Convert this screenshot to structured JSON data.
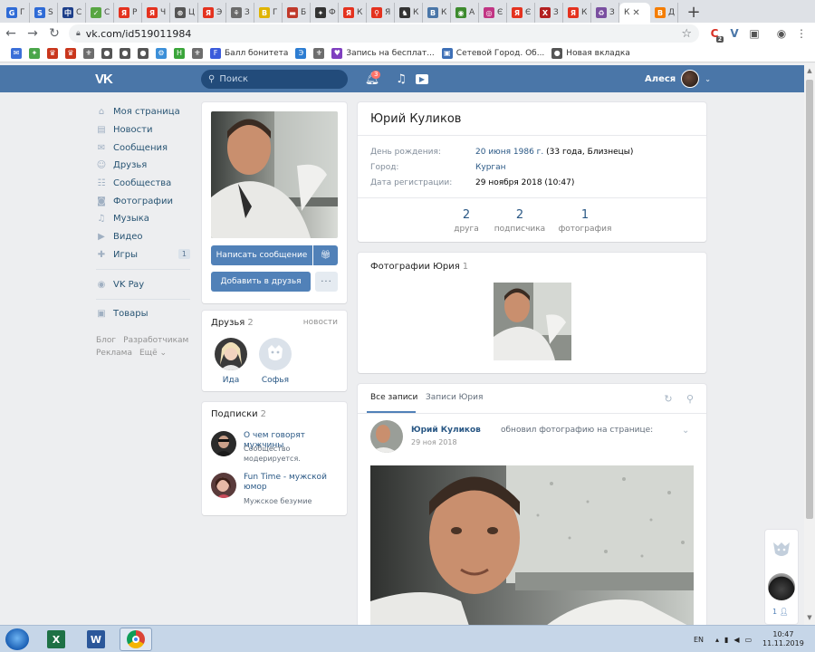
{
  "browser": {
    "tabs": [
      {
        "glyph": "G",
        "color": "#2f6bd6",
        "label": "Г"
      },
      {
        "glyph": "S",
        "color": "#2f6bd6",
        "label": "S"
      },
      {
        "glyph": "中",
        "color": "#1d3f8a",
        "label": "С"
      },
      {
        "glyph": "✓",
        "color": "#58a642",
        "label": "С"
      },
      {
        "glyph": "Я",
        "color": "#e4321f",
        "label": "Р"
      },
      {
        "glyph": "Я",
        "color": "#e4321f",
        "label": "Ч"
      },
      {
        "glyph": "⊛",
        "color": "#555555",
        "label": "Ц"
      },
      {
        "glyph": "Я",
        "color": "#e4321f",
        "label": "Э"
      },
      {
        "glyph": "⚘",
        "color": "#6b6b6b",
        "label": "З"
      },
      {
        "glyph": "B",
        "color": "#e0b400",
        "label": "Г"
      },
      {
        "glyph": "▬",
        "color": "#c0392b",
        "label": "Б"
      },
      {
        "glyph": "✦",
        "color": "#333333",
        "label": "Ф"
      },
      {
        "glyph": "Я",
        "color": "#e4321f",
        "label": "К"
      },
      {
        "glyph": "⚲",
        "color": "#e4321f",
        "label": "Я"
      },
      {
        "glyph": "♞",
        "color": "#333333",
        "label": "К"
      },
      {
        "glyph": "В",
        "color": "#4a76a8",
        "label": "К"
      },
      {
        "glyph": "◉",
        "color": "#3d8b2e",
        "label": "А"
      },
      {
        "glyph": "◎",
        "color": "#c13584",
        "label": "Є"
      },
      {
        "glyph": "Я",
        "color": "#e4321f",
        "label": "Є"
      },
      {
        "glyph": "X",
        "color": "#b32020",
        "label": "З"
      },
      {
        "glyph": "Я",
        "color": "#e4321f",
        "label": "К"
      },
      {
        "glyph": "♻",
        "color": "#7a4fa0",
        "label": "З"
      }
    ],
    "active_tab": {
      "label": "К"
    },
    "trailing_tab": {
      "glyph": "B",
      "color": "#f57d00",
      "label": "Д"
    },
    "url": "vk.com/id519011984",
    "ext_badge": "2",
    "bookmarks": [
      {
        "glyph": "✉",
        "color": "#3b6fd8",
        "label": ""
      },
      {
        "glyph": "✦",
        "color": "#4aa64a",
        "label": ""
      },
      {
        "glyph": "♛",
        "color": "#c9361c",
        "label": ""
      },
      {
        "glyph": "♛",
        "color": "#c9361c",
        "label": ""
      },
      {
        "glyph": "⚜",
        "color": "#6d6d6d",
        "label": ""
      },
      {
        "glyph": "●",
        "color": "#555555",
        "label": ""
      },
      {
        "glyph": "●",
        "color": "#555555",
        "label": ""
      },
      {
        "glyph": "●",
        "color": "#555555",
        "label": ""
      },
      {
        "glyph": "⚙",
        "color": "#3c8fd8",
        "label": ""
      },
      {
        "glyph": "H",
        "color": "#3aa53a",
        "label": ""
      },
      {
        "glyph": "⚜",
        "color": "#6d6d6d",
        "label": ""
      },
      {
        "glyph": "F",
        "color": "#3b5bdb",
        "label": "Балл бонитета"
      },
      {
        "glyph": "Э",
        "color": "#2d7dd2",
        "label": ""
      },
      {
        "glyph": "⚜",
        "color": "#6d6d6d",
        "label": ""
      },
      {
        "glyph": "♥",
        "color": "#7f3fbf",
        "label": "Запись на бесплат..."
      },
      {
        "glyph": "▣",
        "color": "#3d6fb6",
        "label": "Сетевой Город. Об..."
      },
      {
        "glyph": "●",
        "color": "#555555",
        "label": "Новая вкладка"
      }
    ]
  },
  "vk_header": {
    "logo": "VK",
    "search_placeholder": "Поиск",
    "notif_badge": "3",
    "user_name": "Алеся"
  },
  "left_menu": {
    "items": [
      {
        "icon": "home-icon",
        "glyph": "⌂",
        "label": "Моя страница",
        "count": ""
      },
      {
        "icon": "news-icon",
        "glyph": "▤",
        "label": "Новости",
        "count": ""
      },
      {
        "icon": "messages-icon",
        "glyph": "✉",
        "label": "Сообщения",
        "count": ""
      },
      {
        "icon": "friends-icon",
        "glyph": "☺",
        "label": "Друзья",
        "count": ""
      },
      {
        "icon": "communities-icon",
        "glyph": "☷",
        "label": "Сообщества",
        "count": ""
      },
      {
        "icon": "photos-icon",
        "glyph": "◙",
        "label": "Фотографии",
        "count": ""
      },
      {
        "icon": "music-icon",
        "glyph": "♫",
        "label": "Музыка",
        "count": ""
      },
      {
        "icon": "video-icon",
        "glyph": "▶",
        "label": "Видео",
        "count": ""
      },
      {
        "icon": "games-icon",
        "glyph": "✚",
        "label": "Игры",
        "count": "1"
      }
    ],
    "pay": {
      "icon": "vkpay-icon",
      "glyph": "◉",
      "label": "VK Pay"
    },
    "goods": {
      "icon": "goods-icon",
      "glyph": "▣",
      "label": "Товары"
    },
    "footer": [
      "Блог",
      "Разработчикам",
      "Реклама",
      "Ещё ⌄"
    ]
  },
  "profile": {
    "buttons": {
      "message": "Написать сообщение",
      "add_friend": "Добавить в друзья",
      "more": "···"
    },
    "friends": {
      "title": "Друзья",
      "count": "2",
      "link": "новости",
      "list": [
        {
          "name": "Ида"
        },
        {
          "name": "Софья"
        }
      ]
    },
    "subscriptions": {
      "title": "Подписки",
      "count": "2",
      "list": [
        {
          "title": "О чем говорят мужчины",
          "desc": "Сообщество модерируется."
        },
        {
          "title": "Fun Time - мужской юмор",
          "desc": "Мужское безумие"
        }
      ]
    },
    "name": "Юрий Куликов",
    "info": {
      "birthday_label": "День рождения:",
      "birthday_value": "20 июня 1986 г.",
      "birthday_extra": " (33 года, Близнецы)",
      "city_label": "Город:",
      "city_value": "Курган",
      "reg_label": "Дата регистрации:",
      "reg_value": "29 ноября 2018 (10:47)"
    },
    "counters": [
      {
        "num": "2",
        "label": "друга"
      },
      {
        "num": "2",
        "label": "подписчика"
      },
      {
        "num": "1",
        "label": "фотография"
      }
    ],
    "photos": {
      "title": "Фотографии Юрия",
      "count": "1"
    },
    "wall": {
      "tab_all": "Все записи",
      "tab_own": "Записи Юрия",
      "post": {
        "author": "Юрий Куликов",
        "action": "обновил фотографию на странице:",
        "date": "29 ноя 2018"
      }
    },
    "right_counter": "1"
  },
  "taskbar": {
    "lang": "EN",
    "time": "10:47",
    "date": "11.11.2019"
  }
}
